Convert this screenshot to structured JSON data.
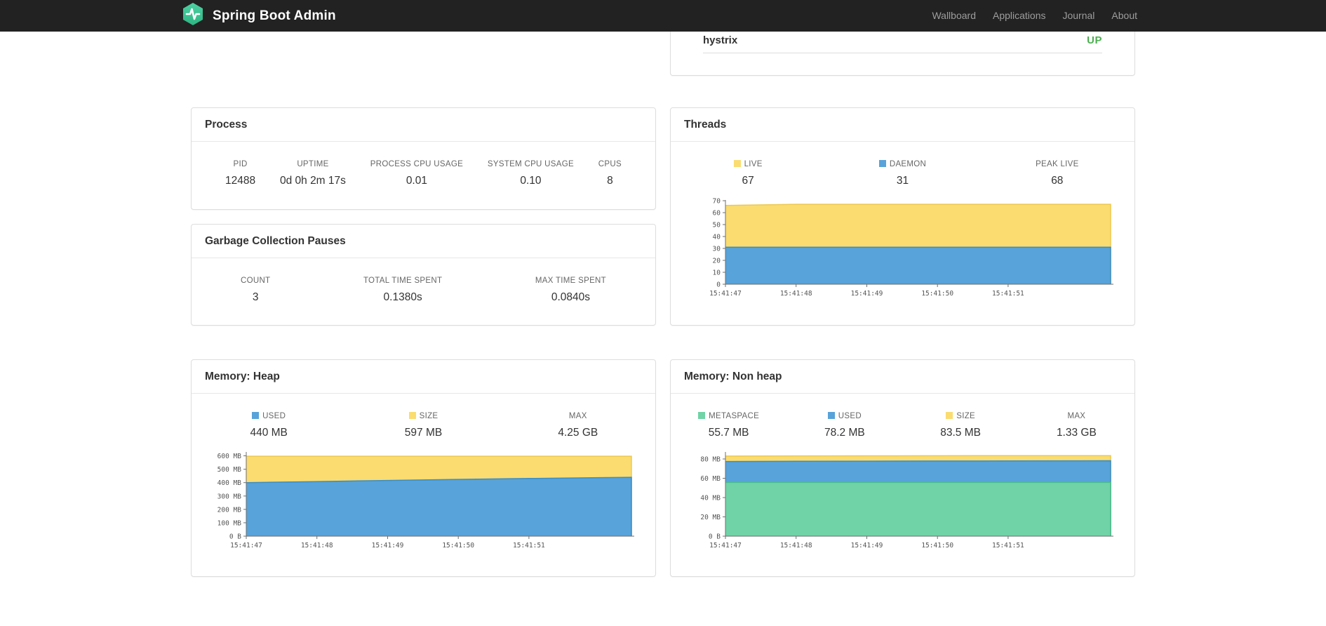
{
  "navbar": {
    "brand": "Spring Boot Admin",
    "items": [
      {
        "label": "Wallboard"
      },
      {
        "label": "Applications"
      },
      {
        "label": "Journal"
      },
      {
        "label": "About"
      }
    ]
  },
  "applications_panel": {
    "app_name": "hystrix",
    "app_status": "UP",
    "status_color": "#4CAF50"
  },
  "process": {
    "title": "Process",
    "metrics": [
      {
        "label": "PID",
        "value": "12488"
      },
      {
        "label": "UPTIME",
        "value": "0d 0h 2m 17s"
      },
      {
        "label": "PROCESS CPU USAGE",
        "value": "0.01"
      },
      {
        "label": "SYSTEM CPU USAGE",
        "value": "0.10"
      },
      {
        "label": "CPUS",
        "value": "8"
      }
    ]
  },
  "gc": {
    "title": "Garbage Collection Pauses",
    "metrics": [
      {
        "label": "COUNT",
        "value": "3"
      },
      {
        "label": "TOTAL TIME SPENT",
        "value": "0.1380s"
      },
      {
        "label": "MAX TIME SPENT",
        "value": "0.0840s"
      }
    ]
  },
  "threads": {
    "title": "Threads",
    "legend": [
      {
        "label": "LIVE",
        "value": "67",
        "swatch": "#FADC70"
      },
      {
        "label": "DAEMON",
        "value": "31",
        "swatch": "#57A3DA"
      },
      {
        "label": "PEAK LIVE",
        "value": "68"
      }
    ]
  },
  "memory_heap": {
    "title": "Memory: Heap",
    "legend": [
      {
        "label": "USED",
        "value": "440 MB",
        "swatch": "#57A3DA"
      },
      {
        "label": "SIZE",
        "value": "597 MB",
        "swatch": "#FADC70"
      },
      {
        "label": "MAX",
        "value": "4.25 GB"
      }
    ]
  },
  "memory_nonheap": {
    "title": "Memory: Non heap",
    "legend": [
      {
        "label": "METASPACE",
        "value": "55.7 MB",
        "swatch": "#6FD3A7"
      },
      {
        "label": "USED",
        "value": "78.2 MB",
        "swatch": "#57A3DA"
      },
      {
        "label": "SIZE",
        "value": "83.5 MB",
        "swatch": "#FADC70"
      },
      {
        "label": "MAX",
        "value": "1.33 GB"
      }
    ]
  },
  "chart_data": [
    {
      "id": "threads",
      "type": "area",
      "title": "Threads",
      "x": [
        0,
        1,
        2,
        3,
        4,
        5,
        5.45
      ],
      "xlim": [
        0,
        5.45
      ],
      "ylim": [
        0,
        70.6
      ],
      "x_ticks": [
        {
          "v": 0,
          "label": "15:41:47"
        },
        {
          "v": 1,
          "label": "15:41:48"
        },
        {
          "v": 2,
          "label": "15:41:49"
        },
        {
          "v": 3,
          "label": "15:41:50"
        },
        {
          "v": 4,
          "label": "15:41:51"
        }
      ],
      "y_ticks": [
        {
          "v": 0,
          "label": "0"
        },
        {
          "v": 10,
          "label": "10"
        },
        {
          "v": 20,
          "label": "20"
        },
        {
          "v": 30,
          "label": "30"
        },
        {
          "v": 40,
          "label": "40"
        },
        {
          "v": 50,
          "label": "50"
        },
        {
          "v": 60,
          "label": "60"
        },
        {
          "v": 70,
          "label": "70"
        }
      ],
      "series": [
        {
          "name": "LIVE",
          "fill": "#FADC70",
          "line": "#EDC84F",
          "values": [
            66,
            67,
            67,
            67,
            67,
            67,
            67
          ]
        },
        {
          "name": "DAEMON",
          "fill": "#57A3DA",
          "line": "#3C8DC5",
          "values": [
            31,
            31,
            31,
            31,
            31,
            31,
            31
          ]
        }
      ]
    },
    {
      "id": "heap",
      "type": "area",
      "title": "Memory: Heap",
      "x": [
        0,
        1,
        2,
        3,
        4,
        5,
        5.45
      ],
      "xlim": [
        0,
        5.45
      ],
      "ylim": [
        0,
        629
      ],
      "x_ticks": [
        {
          "v": 0,
          "label": "15:41:47"
        },
        {
          "v": 1,
          "label": "15:41:48"
        },
        {
          "v": 2,
          "label": "15:41:49"
        },
        {
          "v": 3,
          "label": "15:41:50"
        },
        {
          "v": 4,
          "label": "15:41:51"
        }
      ],
      "y_ticks": [
        {
          "v": 0,
          "label": "0 B"
        },
        {
          "v": 100,
          "label": "100 MB"
        },
        {
          "v": 200,
          "label": "200 MB"
        },
        {
          "v": 300,
          "label": "300 MB"
        },
        {
          "v": 400,
          "label": "400 MB"
        },
        {
          "v": 500,
          "label": "500 MB"
        },
        {
          "v": 600,
          "label": "600 MB"
        }
      ],
      "series": [
        {
          "name": "SIZE",
          "fill": "#FADC70",
          "line": "#EDC84F",
          "values": [
            597,
            597,
            597,
            597,
            597,
            597,
            597
          ]
        },
        {
          "name": "USED",
          "fill": "#57A3DA",
          "line": "#3C8DC5",
          "values": [
            400,
            408,
            416,
            424,
            431,
            437,
            440
          ]
        }
      ]
    },
    {
      "id": "nonheap",
      "type": "area",
      "title": "Memory: Non heap",
      "x": [
        0,
        1,
        2,
        3,
        4,
        5,
        5.45
      ],
      "xlim": [
        0,
        5.45
      ],
      "ylim": [
        0,
        87.3
      ],
      "x_ticks": [
        {
          "v": 0,
          "label": "15:41:47"
        },
        {
          "v": 1,
          "label": "15:41:48"
        },
        {
          "v": 2,
          "label": "15:41:49"
        },
        {
          "v": 3,
          "label": "15:41:50"
        },
        {
          "v": 4,
          "label": "15:41:51"
        }
      ],
      "y_ticks": [
        {
          "v": 0,
          "label": "0 B"
        },
        {
          "v": 20,
          "label": "20 MB"
        },
        {
          "v": 40,
          "label": "40 MB"
        },
        {
          "v": 60,
          "label": "60 MB"
        },
        {
          "v": 80,
          "label": "80 MB"
        }
      ],
      "series": [
        {
          "name": "SIZE",
          "fill": "#FADC70",
          "line": "#EDC84F",
          "values": [
            83,
            83.2,
            83.3,
            83.4,
            83.5,
            83.5,
            83.5
          ]
        },
        {
          "name": "USED",
          "fill": "#57A3DA",
          "line": "#3C8DC5",
          "values": [
            77.4,
            77.6,
            77.8,
            77.9,
            78,
            78.1,
            78.2
          ]
        },
        {
          "name": "METASPACE",
          "fill": "#6FD3A7",
          "line": "#4BBE8B",
          "values": [
            55.7,
            55.7,
            55.7,
            55.7,
            55.7,
            55.7,
            55.7
          ]
        }
      ]
    }
  ]
}
